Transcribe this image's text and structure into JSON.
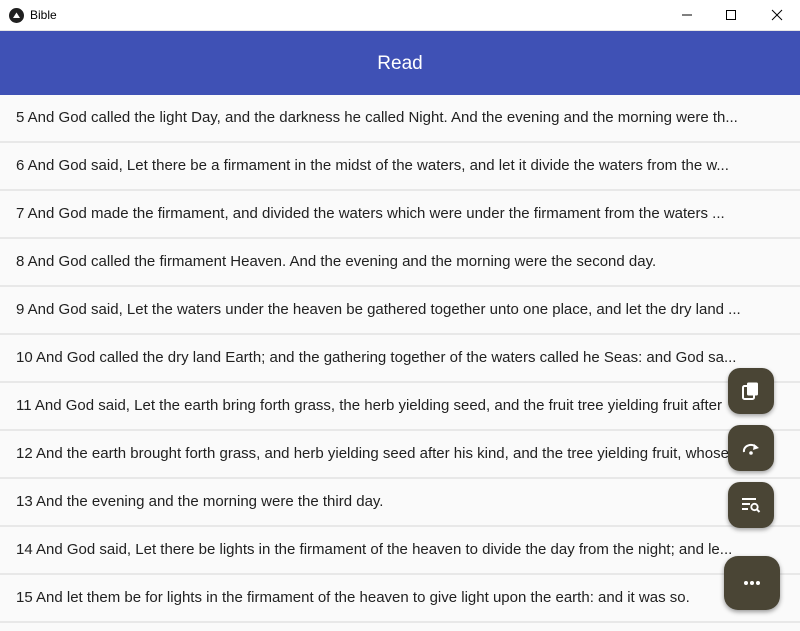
{
  "window": {
    "title": "Bible",
    "icon": "app-logo-icon",
    "controls": [
      "minimize-icon",
      "maximize-icon",
      "close-icon"
    ]
  },
  "appbar": {
    "title": "Read",
    "color": "#3f51b5"
  },
  "verses": [
    "5 And God called the light Day, and the darkness he called Night. And the evening and the morning were th...",
    "6 And God said, Let there be a firmament in the midst of the waters, and let it divide the waters from the w...",
    "7 And God made the firmament, and divided the waters which were under the firmament from the waters ...",
    "8 And God called the firmament Heaven. And the evening and the morning were the second day.",
    "9 And God said, Let the waters under the heaven be gathered together unto one place, and let the dry land ...",
    "10 And God called the dry land Earth; and the gathering together of the waters called he Seas: and God sa...",
    "11 And God said, Let the earth bring forth grass, the herb yielding seed, and the fruit tree yielding fruit after",
    "12 And the earth brought forth grass, and herb yielding seed after his kind, and the tree yielding fruit, whose",
    "13 And the evening and the morning were the third day.",
    "14 And God said, Let there be lights in the firmament of the heaven to divide the day from the night; and le...",
    "15 And let them be for lights in the firmament of the heaven to give light upon the earth: and it was so."
  ],
  "fabs": {
    "copy": "copy-icon",
    "jump": "redo-arrow-icon",
    "search": "search-list-icon",
    "more": "more-dots-icon",
    "color": "#4a4535"
  }
}
